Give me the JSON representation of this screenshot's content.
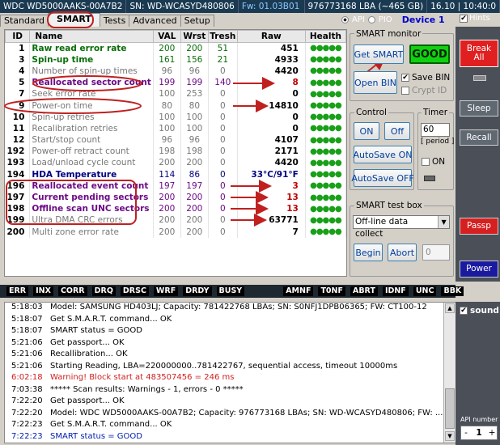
{
  "topbar": {
    "drive": "WDC WD5000AAKS-00A7B2",
    "sn": "SN: WD-WCASYD480806",
    "fw": "Fw: 01.03B01",
    "lba": "976773168 LBA (~465 GB)",
    "time": "16.10 | 10:40:0"
  },
  "tabs": [
    "Standard",
    "SMART",
    "Tests",
    "Advanced",
    "Setup"
  ],
  "api": {
    "api_label": "API",
    "pio_label": "PIO",
    "device": "Device 1",
    "hints": "Hints"
  },
  "table": {
    "headers": [
      "ID",
      "Name",
      "VAL",
      "Wrst",
      "Tresh",
      "Raw",
      "Health"
    ],
    "rows": [
      {
        "id": "1",
        "name": "Raw read error rate",
        "val": "200",
        "wrst": "200",
        "tresh": "51",
        "raw": "451",
        "health": "●●●●●",
        "style": "green"
      },
      {
        "id": "3",
        "name": "Spin-up time",
        "val": "161",
        "wrst": "156",
        "tresh": "21",
        "raw": "4933",
        "health": "●●●●●",
        "style": "green"
      },
      {
        "id": "4",
        "name": "Number of spin-up times",
        "val": "96",
        "wrst": "96",
        "tresh": "0",
        "raw": "4420",
        "health": "●●●●●",
        "style": "grey"
      },
      {
        "id": "5",
        "name": "Reallocated sector count",
        "val": "199",
        "wrst": "199",
        "tresh": "140",
        "raw": "8",
        "health": "●●●●●",
        "style": "purple"
      },
      {
        "id": "7",
        "name": "Seek error rate",
        "val": "100",
        "wrst": "253",
        "tresh": "0",
        "raw": "0",
        "health": "●●●●●",
        "style": "grey"
      },
      {
        "id": "9",
        "name": "Power-on time",
        "val": "80",
        "wrst": "80",
        "tresh": "0",
        "raw": "14810",
        "health": "●●●●●",
        "style": "grey"
      },
      {
        "id": "10",
        "name": "Spin-up retries",
        "val": "100",
        "wrst": "100",
        "tresh": "0",
        "raw": "0",
        "health": "●●●●●",
        "style": "grey"
      },
      {
        "id": "11",
        "name": "Recalibration retries",
        "val": "100",
        "wrst": "100",
        "tresh": "0",
        "raw": "0",
        "health": "●●●●●",
        "style": "grey"
      },
      {
        "id": "12",
        "name": "Start/stop count",
        "val": "96",
        "wrst": "96",
        "tresh": "0",
        "raw": "4107",
        "health": "●●●●●",
        "style": "grey"
      },
      {
        "id": "192",
        "name": "Power-off retract count",
        "val": "198",
        "wrst": "198",
        "tresh": "0",
        "raw": "2171",
        "health": "●●●●●",
        "style": "grey"
      },
      {
        "id": "193",
        "name": "Load/unload cycle count",
        "val": "200",
        "wrst": "200",
        "tresh": "0",
        "raw": "4420",
        "health": "●●●●●",
        "style": "grey"
      },
      {
        "id": "194",
        "name": "HDA Temperature",
        "val": "114",
        "wrst": "86",
        "tresh": "0",
        "raw": "33°C/91°F",
        "health": "●●●●●",
        "style": "blue"
      },
      {
        "id": "196",
        "name": "Reallocated event count",
        "val": "197",
        "wrst": "197",
        "tresh": "0",
        "raw": "3",
        "health": "●●●●●",
        "style": "purple"
      },
      {
        "id": "197",
        "name": "Current pending sectors",
        "val": "200",
        "wrst": "200",
        "tresh": "0",
        "raw": "13",
        "health": "●●●●●",
        "style": "purple"
      },
      {
        "id": "198",
        "name": "Offline scan UNC sectors",
        "val": "200",
        "wrst": "200",
        "tresh": "0",
        "raw": "13",
        "health": "●●●●●",
        "style": "purple"
      },
      {
        "id": "199",
        "name": "Ultra DMA CRC errors",
        "val": "200",
        "wrst": "200",
        "tresh": "0",
        "raw": "63771",
        "health": "●●●●●",
        "style": "grey"
      },
      {
        "id": "200",
        "name": "Multi zone error rate",
        "val": "200",
        "wrst": "200",
        "tresh": "0",
        "raw": "7",
        "health": "●●●●●",
        "style": "grey"
      }
    ]
  },
  "smart_monitor": {
    "title": "SMART monitor",
    "get_smart": "Get SMART",
    "status": "GOOD",
    "open_bin": "Open BIN",
    "save_bin": "Save BIN",
    "crypt_id": "Crypt ID"
  },
  "control": {
    "title": "Control",
    "on": "ON",
    "off": "Off",
    "autosave_on": "AutoSave ON",
    "autosave_off": "AutoSave OFF"
  },
  "timer": {
    "title": "Timer",
    "value": "60",
    "period": "[ period ]",
    "on": "ON"
  },
  "test_box": {
    "title": "SMART test box",
    "selected": "Off-line data collect",
    "begin": "Begin",
    "abort": "Abort",
    "value": "0"
  },
  "right": {
    "break_all": "Break All",
    "sleep": "Sleep",
    "recall": "Recall",
    "passp": "Passp",
    "power": "Power",
    "sound": "sound",
    "api_number_label": "API number",
    "api_number": "1"
  },
  "status_icons": [
    "ERR",
    "INX",
    "CORR",
    "DRQ",
    "DRSC",
    "WRF",
    "DRDY",
    "BUSY",
    "AMNF",
    "T0NF",
    "ABRT",
    "IDNF",
    "UNC",
    "BBK"
  ],
  "log": [
    {
      "t": "5:18:03",
      "m": "Model: SAMSUNG HD403LJ; Capacity: 781422768 LBAs; SN: S0NFJ1DPB06365; FW: CT100-12",
      "c": ""
    },
    {
      "t": "5:18:07",
      "m": "Get S.M.A.R.T. command... OK",
      "c": ""
    },
    {
      "t": "5:18:07",
      "m": "SMART status = GOOD",
      "c": ""
    },
    {
      "t": "5:21:06",
      "m": "Get passport... OK",
      "c": ""
    },
    {
      "t": "5:21:06",
      "m": "Recallibration... OK",
      "c": ""
    },
    {
      "t": "5:21:06",
      "m": "Starting Reading, LBA=220000000..781422767, sequential access, timeout 10000ms",
      "c": ""
    },
    {
      "t": "6:02:18",
      "m": "Warning! Block start at 483507456 = 246 ms",
      "c": "warn"
    },
    {
      "t": "7:03:38",
      "m": "***** Scan results: Warnings - 1, errors - 0 *****",
      "c": ""
    },
    {
      "t": "7:22:20",
      "m": "Get passport... OK",
      "c": ""
    },
    {
      "t": "7:22:20",
      "m": "Model: WDC WD5000AAKS-00A7B2; Capacity: 976773168 LBAs; SN: WD-WCASYD480806; FW: ...",
      "c": ""
    },
    {
      "t": "7:22:23",
      "m": "Get S.M.A.R.T. command... OK",
      "c": ""
    },
    {
      "t": "7:22:23",
      "m": "SMART status = GOOD",
      "c": "okc"
    }
  ]
}
